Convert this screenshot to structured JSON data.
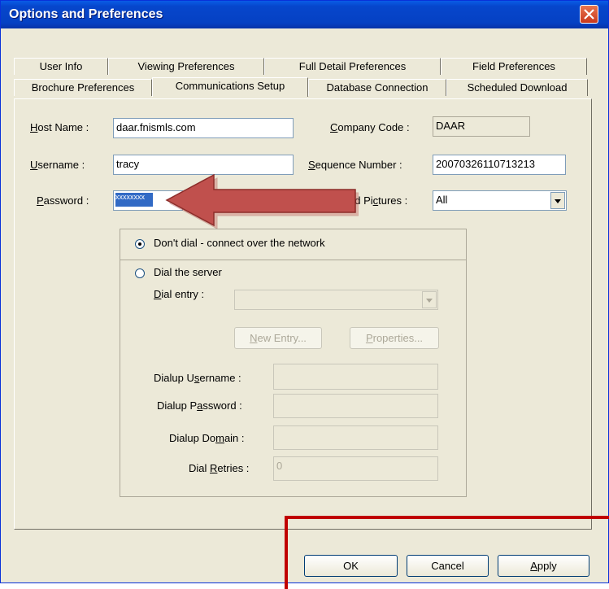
{
  "window": {
    "title": "Options and Preferences"
  },
  "tabs_row1": [
    {
      "label": "User Info"
    },
    {
      "label": "Viewing Preferences"
    },
    {
      "label": "Full Detail Preferences"
    },
    {
      "label": "Field Preferences"
    }
  ],
  "tabs_row2": [
    {
      "label": "Brochure Preferences"
    },
    {
      "label": "Communications Setup",
      "active": true
    },
    {
      "label": "Database Connection"
    },
    {
      "label": "Scheduled Download"
    }
  ],
  "form": {
    "host_name_label_a": "H",
    "host_name_label_b": "ost Name :",
    "host_name_value": "daar.fnismls.com",
    "company_code_label_a": "C",
    "company_code_label_b": "ompany Code :",
    "company_code_value": "DAAR",
    "username_label_a": "U",
    "username_label_b": "sername :",
    "username_value": "tracy",
    "sequence_label_a": "S",
    "sequence_label_b": "equence Number :",
    "sequence_value": "20070326110713213",
    "password_label_a": "P",
    "password_label_b": "assword :",
    "password_value": "xxxxxxxx",
    "pictures_label_a": "ad Pi",
    "pictures_label_b": "c",
    "pictures_label_c": "tures :",
    "pictures_value": "All"
  },
  "connection": {
    "option_network": "Don't dial - connect over the network",
    "option_dial": "Dial the server",
    "dial_entry_label_a": "D",
    "dial_entry_label_b": "ial entry :",
    "new_entry_a": "N",
    "new_entry_b": "ew Entry...",
    "properties_a": "P",
    "properties_b": "roperties...",
    "dialup_username_a": "Dialup U",
    "dialup_username_b": "s",
    "dialup_username_c": "ername :",
    "dialup_password_a": "Dialup P",
    "dialup_password_b": "a",
    "dialup_password_c": "ssword :",
    "dialup_domain_a": "Dialup Do",
    "dialup_domain_b": "m",
    "dialup_domain_c": "ain :",
    "dial_retries_a": "Dial ",
    "dial_retries_b": "R",
    "dial_retries_c": "etries :",
    "dial_retries_value": "0"
  },
  "buttons": {
    "ok": "OK",
    "cancel": "Cancel",
    "apply_a": "A",
    "apply_b": "pply"
  },
  "colors": {
    "arrow": "#c0504d",
    "highlight_box": "#c00000",
    "titlebar": "#0541c3"
  }
}
